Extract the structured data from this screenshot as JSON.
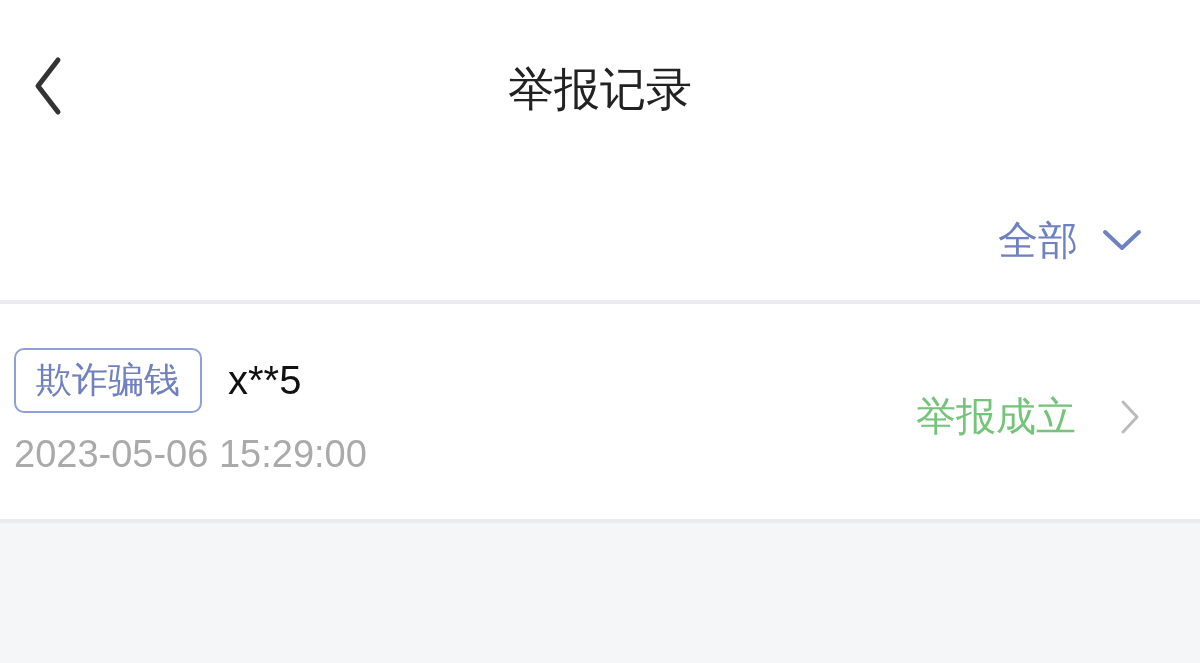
{
  "header": {
    "title": "举报记录"
  },
  "filter": {
    "label": "全部",
    "expanded": false
  },
  "records": [
    {
      "tag": "欺诈骗钱",
      "name": "x**5",
      "time": "2023-05-06 15:29:00",
      "status": "举报成立",
      "kind": "success"
    }
  ]
}
